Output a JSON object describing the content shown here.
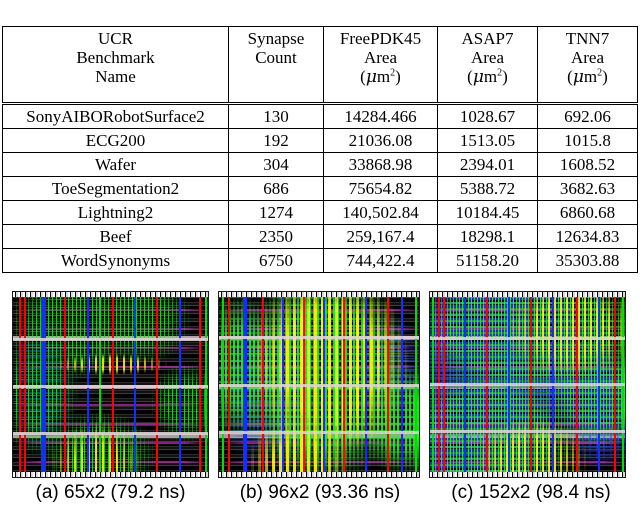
{
  "table": {
    "columns": [
      {
        "key": "benchmark",
        "lines": [
          "UCR",
          "Benchmark",
          "Name"
        ]
      },
      {
        "key": "synapses",
        "lines": [
          "Synapse",
          "Count"
        ]
      },
      {
        "key": "freepdk45",
        "lines": [
          "FreePDK45",
          "Area"
        ],
        "units": "(μm2)"
      },
      {
        "key": "asap7",
        "lines": [
          "ASAP7",
          "Area"
        ],
        "units": "(μm2)"
      },
      {
        "key": "tnn7",
        "lines": [
          "TNN7",
          "Area"
        ],
        "units": "(μm2)"
      }
    ],
    "rows": [
      {
        "benchmark": "SonyAIBORobotSurface2",
        "synapses": "130",
        "freepdk45": "14284.466",
        "asap7": "1028.67",
        "tnn7": "692.06"
      },
      {
        "benchmark": "ECG200",
        "synapses": "192",
        "freepdk45": "21036.08",
        "asap7": "1513.05",
        "tnn7": "1015.8"
      },
      {
        "benchmark": "Wafer",
        "synapses": "304",
        "freepdk45": "33868.98",
        "asap7": "2394.01",
        "tnn7": "1608.52"
      },
      {
        "benchmark": "ToeSegmentation2",
        "synapses": "686",
        "freepdk45": "75654.82",
        "asap7": "5388.72",
        "tnn7": "3682.63"
      },
      {
        "benchmark": "Lightning2",
        "synapses": "1274",
        "freepdk45": "140,502.84",
        "asap7": "10184.45",
        "tnn7": "6860.68"
      },
      {
        "benchmark": "Beef",
        "synapses": "2350",
        "freepdk45": "259,167.4",
        "asap7": "18298.1",
        "tnn7": "12634.83"
      },
      {
        "benchmark": "WordSynonyms",
        "synapses": "6750",
        "freepdk45": "744,422.4",
        "asap7": "51158.20",
        "tnn7": "35303.88"
      }
    ]
  },
  "figure": {
    "panels": [
      {
        "id": "a",
        "caption": "(a) 65x2 (79.2 ns)",
        "label": "(a)",
        "config": "65x2",
        "delay": "79.2 ns"
      },
      {
        "id": "b",
        "caption": "(b) 96x2 (93.36 ns)",
        "label": "(b)",
        "config": "96x2",
        "delay": "93.36 ns"
      },
      {
        "id": "c",
        "caption": "(c) 152x2 (98.4 ns)",
        "label": "(c)",
        "config": "152x2",
        "delay": "98.4 ns"
      }
    ],
    "colors": {
      "background": "#000000",
      "metal_green": "#14f014",
      "metal_yellow": "#fff00a",
      "metal_blue": "#2830f5",
      "metal_red": "#ff0000",
      "metal_magenta": "#e128d2",
      "power_rail": "#cdb9c3"
    }
  }
}
